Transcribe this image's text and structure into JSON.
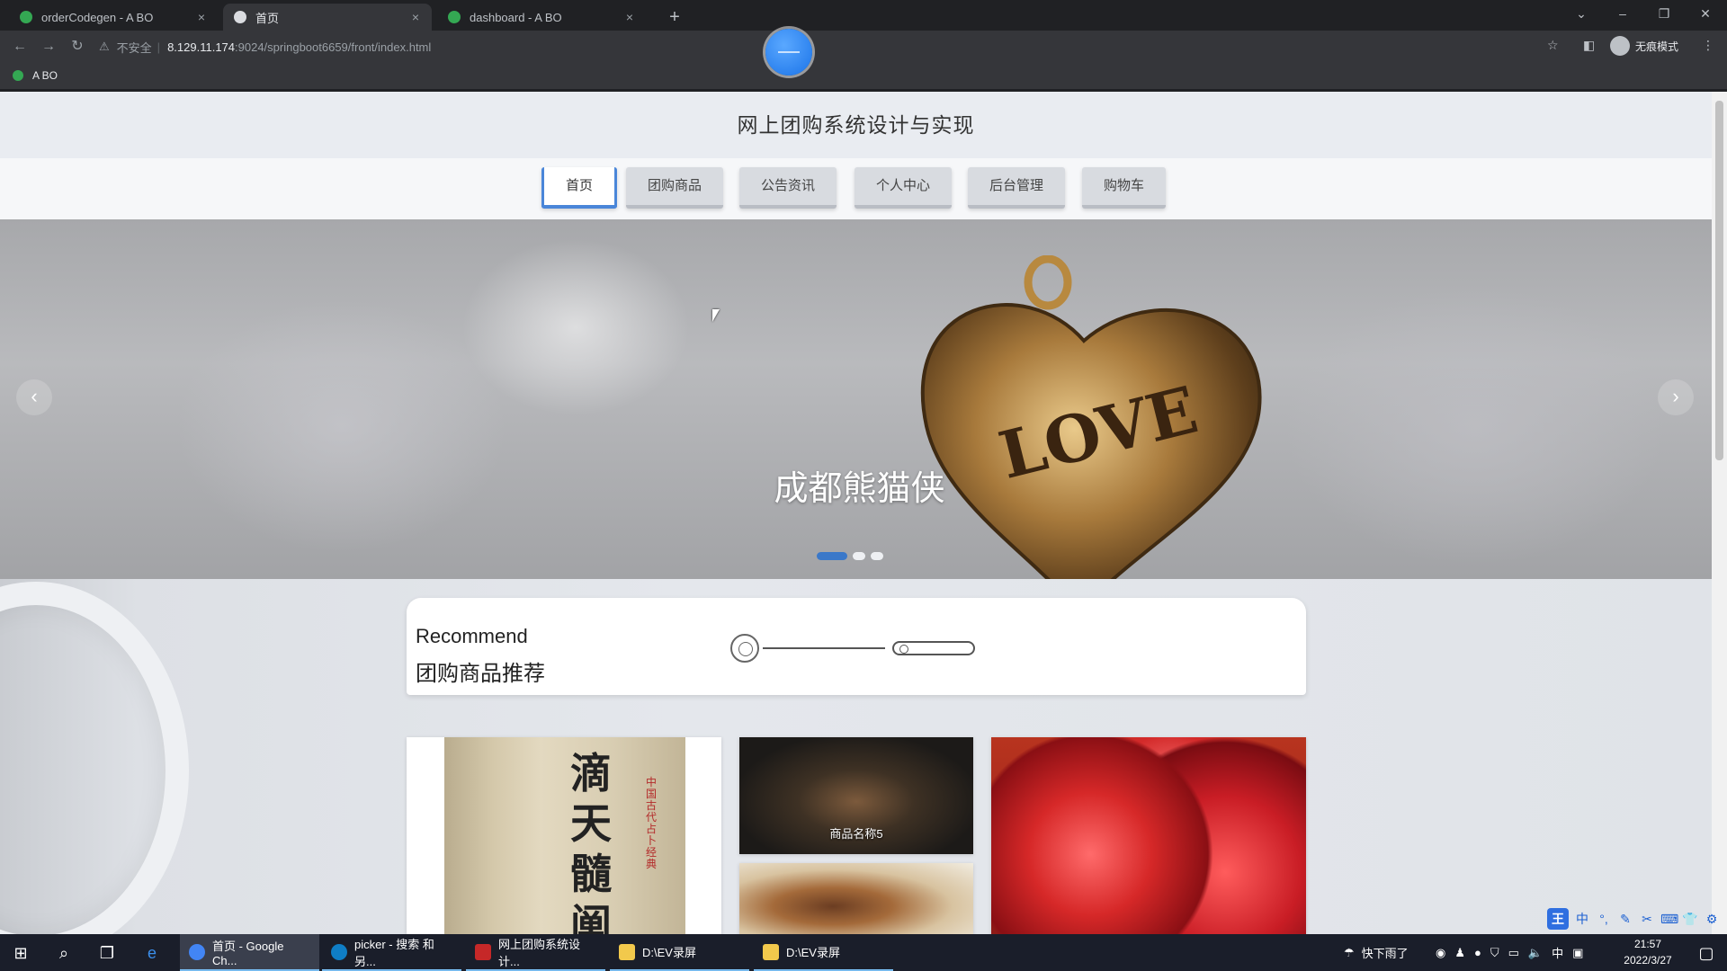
{
  "browser": {
    "tabs": [
      {
        "title": "orderCodegen - A BO",
        "close": "×"
      },
      {
        "title": "首页",
        "close": "×"
      },
      {
        "title": "dashboard - A BO",
        "close": "×"
      }
    ],
    "new_tab": "+",
    "address": {
      "insecure_label": "不安全",
      "separator": "|",
      "host": "8.129.11.174",
      "path": ":9024/springboot6659/front/index.html"
    },
    "incognito_label": "无痕模式",
    "bookmark": "A BO"
  },
  "page": {
    "site_title": "网上团购系统设计与实现",
    "nav": [
      {
        "label": "首页",
        "active": true
      },
      {
        "label": "团购商品",
        "active": false
      },
      {
        "label": "公告资讯",
        "active": false
      },
      {
        "label": "个人中心",
        "active": false
      },
      {
        "label": "后台管理",
        "active": false
      },
      {
        "label": "购物车",
        "active": false
      }
    ],
    "banner": {
      "caption": "成都熊猫侠",
      "heart_text": "LOVE",
      "prev": "‹",
      "next": "›",
      "dots": 3,
      "active_dot": 0
    },
    "recommend": {
      "title_en": "Recommend",
      "title_cn": "团购商品推荐"
    },
    "products": [
      {
        "name": "",
        "image": "book"
      },
      {
        "name": "商品名称5",
        "image": "food-platter"
      },
      {
        "name": "",
        "image": "food-dish"
      },
      {
        "name": "",
        "image": "cherries"
      }
    ],
    "book_chars": [
      "滴",
      "天",
      "髓",
      "阐"
    ],
    "book_side_text": "中国古代占卜经典"
  },
  "taskbar": {
    "tasks": [
      {
        "label": "首页 - Google Ch...",
        "active": true,
        "color": "#4285f4"
      },
      {
        "label": "picker - 搜索 和另...",
        "active": false,
        "color": "#0f7ec6"
      },
      {
        "label": "网上团购系统设计...",
        "active": false,
        "color": "#c62828"
      },
      {
        "label": "D:\\EV录屏",
        "active": false,
        "color": "#f2c94c"
      },
      {
        "label": "D:\\EV录屏",
        "active": false,
        "color": "#f2c94c"
      }
    ],
    "weather": "快下雨了",
    "ime_lang": "中",
    "time": "21:57",
    "date": "2022/3/27"
  },
  "colors": {
    "accent": "#4a86d9",
    "dot_active": "#3a78c9"
  }
}
